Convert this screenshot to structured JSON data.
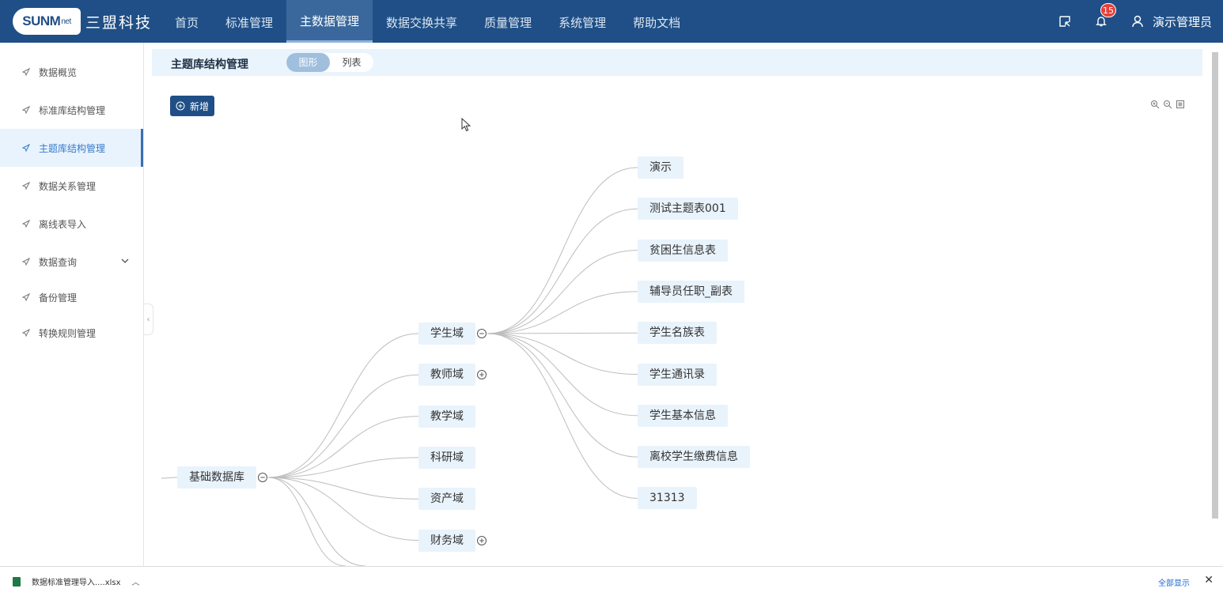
{
  "header": {
    "brand_badge": "SUNM",
    "brand_badge_suffix": "net",
    "brand_name": "三盟科技",
    "nav": [
      "首页",
      "标准管理",
      "主数据管理",
      "数据交换共享",
      "质量管理",
      "系统管理",
      "帮助文档"
    ],
    "active_nav_index": 2,
    "notification_count": "15",
    "username": "演示管理员"
  },
  "sidebar": {
    "items": [
      "数据概览",
      "标准库结构管理",
      "主题库结构管理",
      "数据关系管理",
      "离线表导入",
      "数据查询",
      "备份管理",
      "转换规则管理"
    ],
    "active_index": 2,
    "expandable_index": 5
  },
  "main": {
    "page_title": "主题库结构管理",
    "view_toggle": [
      "图形",
      "列表"
    ],
    "active_view": 0,
    "add_button": "新增",
    "zoom_tools": [
      "zoom-in-icon",
      "zoom-out-icon",
      "fit-screen-icon"
    ],
    "tree": {
      "root": "基础数据库",
      "domains": [
        "学生域",
        "教师域",
        "教学域",
        "科研域",
        "资产域",
        "财务域"
      ],
      "expanded_domain": "学生域",
      "collapsed_domains": [
        "教师域",
        "财务域"
      ],
      "student_tables": [
        "演示",
        "测试主题表001",
        "贫困生信息表",
        "辅导员任职_副表",
        "学生名族表",
        "学生通讯录",
        "学生基本信息",
        "离校学生缴费信息",
        "31313"
      ]
    }
  },
  "download_bar": {
    "file_name": "数据标准管理导入....xlsx",
    "show_all": "全部显示"
  },
  "colors": {
    "header": "#1f4f86",
    "accent": "#3a7bc8",
    "node_bg": "#e9f3fc"
  }
}
